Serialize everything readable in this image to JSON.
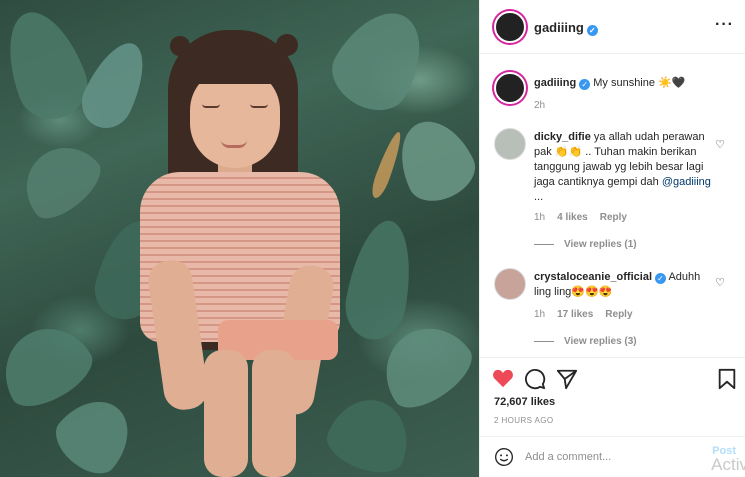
{
  "post": {
    "username": "gadiiing",
    "caption": "My sunshine ☀️🖤",
    "caption_time": "2h",
    "likes": "72,607 likes",
    "time_ago": "2 HOURS AGO"
  },
  "comments": [
    {
      "username": "dicky_difie",
      "text": "ya allah udah perawan pak 👏👏 .. Tuhan makin berikan tanggung jawab yg lebih besar lagi jaga cantiknya gempi dah ",
      "mention": "@gadiiing",
      "suffix": " ...",
      "time": "1h",
      "likes": "4 likes",
      "reply": "Reply",
      "view_replies": "View replies (1)"
    },
    {
      "username": "crystaloceanie_official",
      "text": "Aduhh ling ling😍😍😍",
      "time": "1h",
      "likes": "17 likes",
      "reply": "Reply",
      "view_replies": "View replies (3)"
    }
  ],
  "composer": {
    "placeholder": "Add a comment...",
    "post_label": "Post",
    "overlay_text": "Activ"
  },
  "colors": {
    "like_red": "#ed4956",
    "verified_blue": "#3897f0",
    "post_button": "#b2dffc"
  },
  "icons": [
    "heart-icon",
    "comment-icon",
    "share-icon",
    "bookmark-icon",
    "emoji-icon",
    "more-icon",
    "verified-icon"
  ]
}
